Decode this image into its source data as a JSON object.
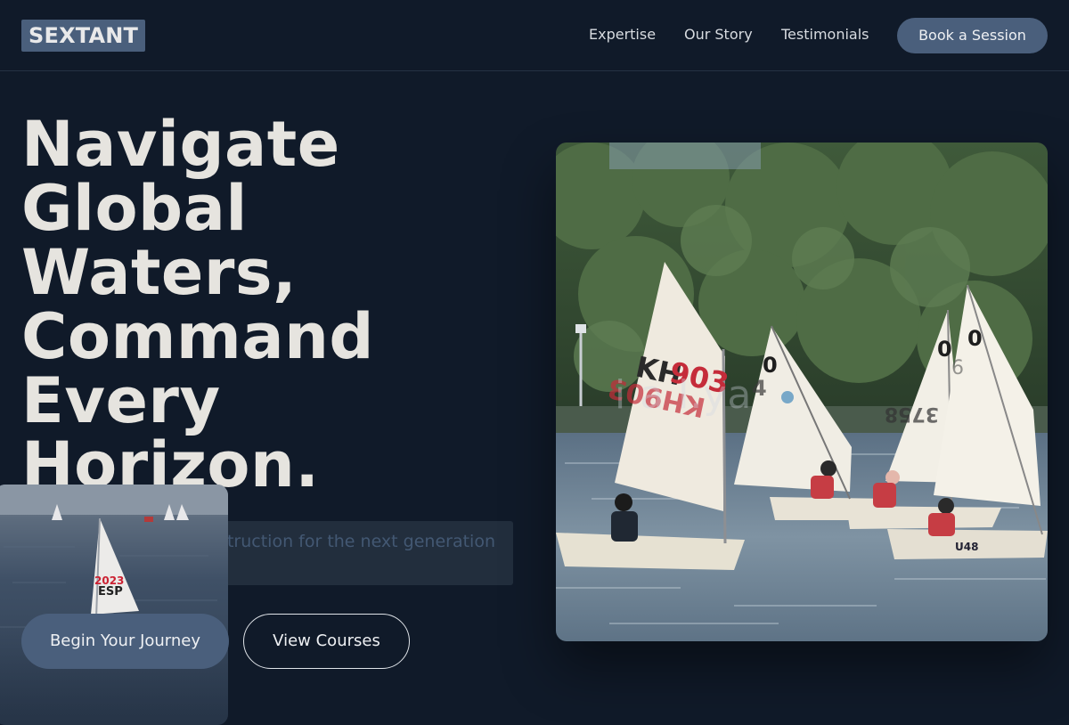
{
  "brand": {
    "name": "SEXTANT"
  },
  "nav": {
    "links": [
      "Expertise",
      "Our Story",
      "Testimonials"
    ],
    "cta": "Book a Session"
  },
  "hero": {
    "title": "Navigate Global Waters, Command Every Horizon.",
    "subtitle": "Professional sailing instruction for the next generation of mariners.",
    "ghost_text": "informational",
    "primary_button": "Begin Your Journey",
    "secondary_button": "View Courses",
    "image_watermark": "i        a        l.ya",
    "sail_numbers": [
      "KH903",
      "0",
      "4",
      "0",
      "0",
      "U48"
    ],
    "card_sail_number": "ESP 20237"
  },
  "colors": {
    "background": "#101a29",
    "accent": "#4a5f7c",
    "text": "#e6e4df"
  }
}
